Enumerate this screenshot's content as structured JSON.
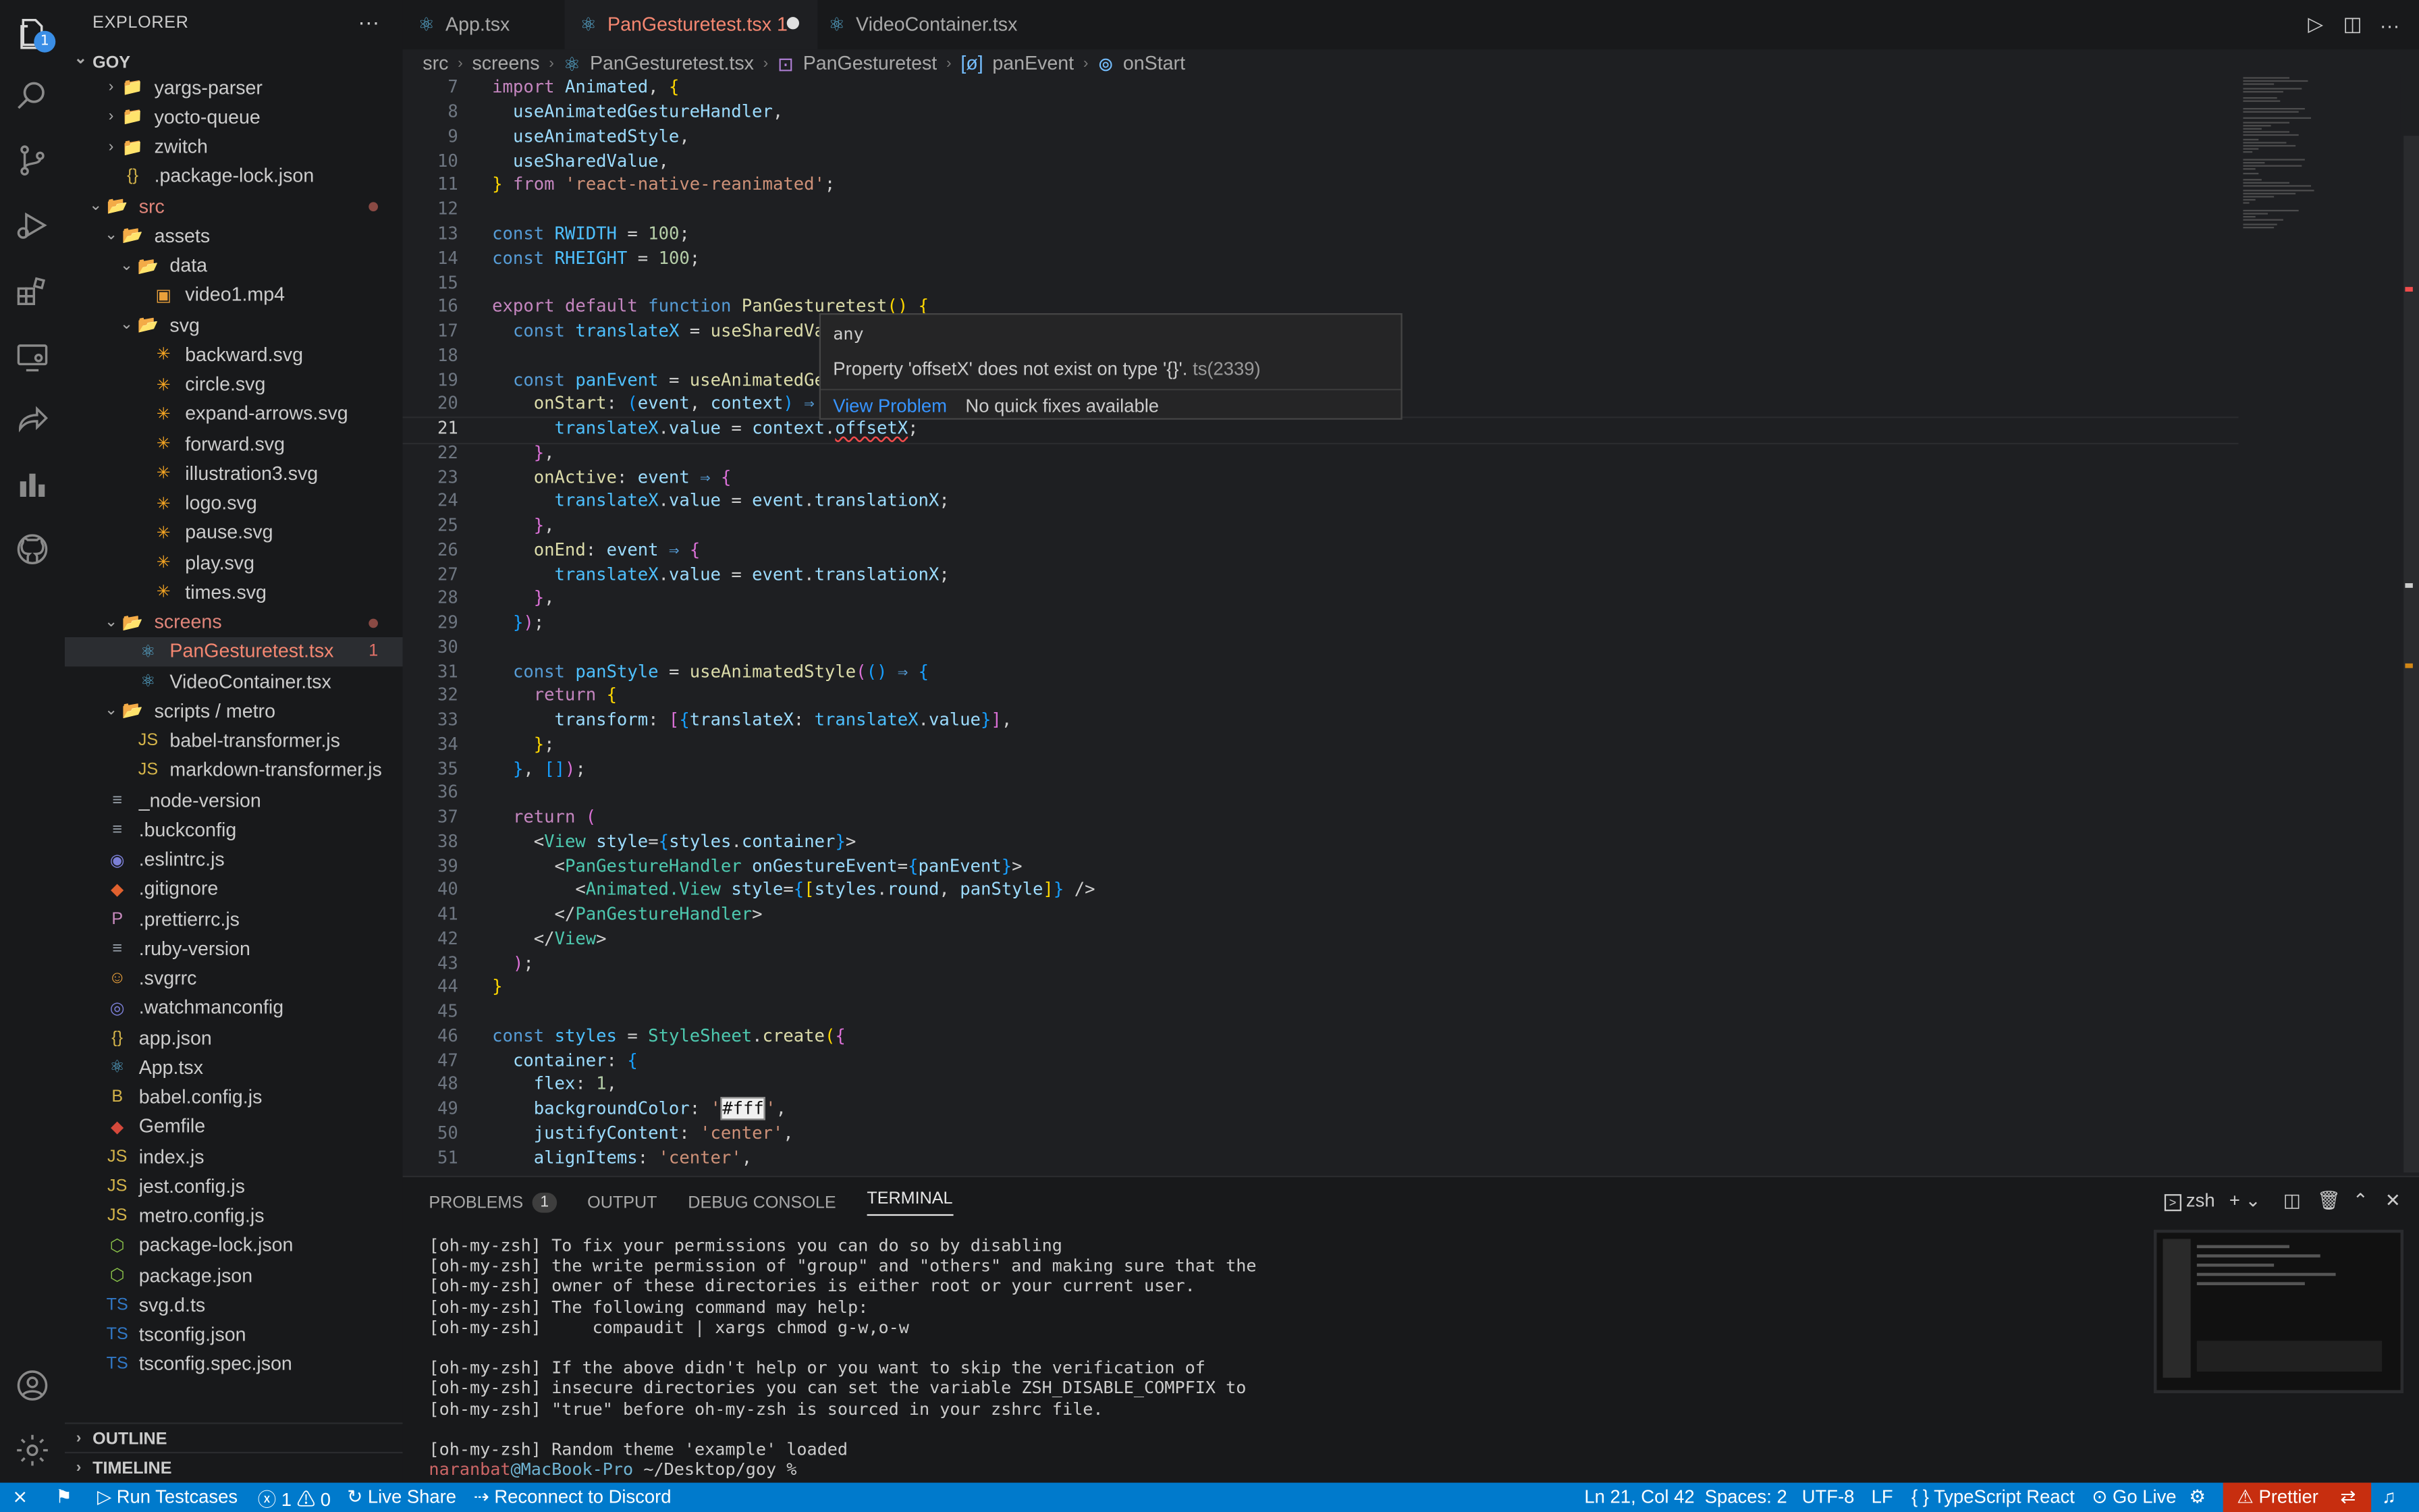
{
  "activity": {
    "explorer_badge": "1"
  },
  "sidebar": {
    "title": "EXPLORER",
    "more": "···",
    "root": "GOY",
    "items": [
      {
        "label": "yargs-parser",
        "kind": "folder",
        "depth": 1
      },
      {
        "label": "yocto-queue",
        "kind": "folder",
        "depth": 1
      },
      {
        "label": "zwitch",
        "kind": "folder",
        "depth": 1
      },
      {
        "label": ".package-lock.json",
        "kind": "json",
        "depth": 1
      },
      {
        "label": "src",
        "kind": "folder-open",
        "depth": 0
      },
      {
        "label": "assets",
        "kind": "folder-open",
        "depth": 1
      },
      {
        "label": "data",
        "kind": "folder-open",
        "depth": 2
      },
      {
        "label": "video1.mp4",
        "kind": "media",
        "depth": 3
      },
      {
        "label": "svg",
        "kind": "folder-open",
        "depth": 2
      },
      {
        "label": "backward.svg",
        "kind": "svg",
        "depth": 3
      },
      {
        "label": "circle.svg",
        "kind": "svg",
        "depth": 3
      },
      {
        "label": "expand-arrows.svg",
        "kind": "svg",
        "depth": 3
      },
      {
        "label": "forward.svg",
        "kind": "svg",
        "depth": 3
      },
      {
        "label": "illustration3.svg",
        "kind": "svg",
        "depth": 3
      },
      {
        "label": "logo.svg",
        "kind": "svg",
        "depth": 3
      },
      {
        "label": "pause.svg",
        "kind": "svg",
        "depth": 3
      },
      {
        "label": "play.svg",
        "kind": "svg",
        "depth": 3
      },
      {
        "label": "times.svg",
        "kind": "svg",
        "depth": 3
      },
      {
        "label": "screens",
        "kind": "folder-open",
        "depth": 1
      },
      {
        "label": "PanGesturetest.tsx",
        "kind": "react",
        "depth": 2,
        "problems": "1"
      },
      {
        "label": "VideoContainer.tsx",
        "kind": "react",
        "depth": 2
      },
      {
        "label": "scripts / metro",
        "kind": "folder-open",
        "depth": 1
      },
      {
        "label": "babel-transformer.js",
        "kind": "js",
        "depth": 2
      },
      {
        "label": "markdown-transformer.js",
        "kind": "js",
        "depth": 2
      },
      {
        "label": "_node-version",
        "kind": "text",
        "depth": 0
      },
      {
        "label": ".buckconfig",
        "kind": "text",
        "depth": 0
      },
      {
        "label": ".eslintrc.js",
        "kind": "eslint",
        "depth": 0
      },
      {
        "label": ".gitignore",
        "kind": "git",
        "depth": 0
      },
      {
        "label": ".prettierrc.js",
        "kind": "prettier",
        "depth": 0
      },
      {
        "label": ".ruby-version",
        "kind": "text",
        "depth": 0
      },
      {
        "label": ".svgrrc",
        "kind": "svgr",
        "depth": 0
      },
      {
        "label": ".watchmanconfig",
        "kind": "watchman",
        "depth": 0
      },
      {
        "label": "app.json",
        "kind": "json",
        "depth": 0
      },
      {
        "label": "App.tsx",
        "kind": "react",
        "depth": 0
      },
      {
        "label": "babel.config.js",
        "kind": "babel",
        "depth": 0
      },
      {
        "label": "Gemfile",
        "kind": "ruby",
        "depth": 0
      },
      {
        "label": "index.js",
        "kind": "js",
        "depth": 0
      },
      {
        "label": "jest.config.js",
        "kind": "js",
        "depth": 0
      },
      {
        "label": "metro.config.js",
        "kind": "js",
        "depth": 0
      },
      {
        "label": "package-lock.json",
        "kind": "node",
        "depth": 0
      },
      {
        "label": "package.json",
        "kind": "node",
        "depth": 0
      },
      {
        "label": "svg.d.ts",
        "kind": "ts",
        "depth": 0
      },
      {
        "label": "tsconfig.json",
        "kind": "ts",
        "depth": 0
      },
      {
        "label": "tsconfig.spec.json",
        "kind": "ts",
        "depth": 0
      }
    ],
    "outline": "OUTLINE",
    "timeline": "TIMELINE"
  },
  "tabs": [
    {
      "label": "App.tsx"
    },
    {
      "label": "PanGesturetest.tsx 1"
    },
    {
      "label": "VideoContainer.tsx"
    }
  ],
  "breadcrumb": [
    "src",
    "screens",
    "PanGesturetest.tsx",
    "PanGesturetest",
    "panEvent",
    "onStart"
  ],
  "editor": {
    "line_numbers": [
      "7",
      "8",
      "9",
      "10",
      "11",
      "12",
      "13",
      "14",
      "15",
      "16",
      "17",
      "18",
      "19",
      "20",
      "21",
      "22",
      "23",
      "24",
      "25",
      "26",
      "27",
      "28",
      "29",
      "30",
      "31",
      "32",
      "33",
      "34",
      "35",
      "36",
      "37",
      "38",
      "39",
      "40",
      "41",
      "42",
      "43",
      "44",
      "45",
      "46",
      "47",
      "48",
      "49",
      "50",
      "51"
    ],
    "current_line": "21"
  },
  "hover": {
    "type": "any",
    "message": "Property 'offsetX' does not exist on type '{}'.",
    "code": "ts(2339)",
    "view_problem": "View Problem",
    "no_fix": "No quick fixes available"
  },
  "panel": {
    "tabs": [
      "PROBLEMS",
      "OUTPUT",
      "DEBUG CONSOLE",
      "TERMINAL"
    ],
    "problems_count": "1",
    "shell": "zsh",
    "terminal_lines": [
      "[oh-my-zsh] To fix your permissions you can do so by disabling",
      "[oh-my-zsh] the write permission of \"group\" and \"others\" and making sure that the",
      "[oh-my-zsh] owner of these directories is either root or your current user.",
      "[oh-my-zsh] The following command may help:",
      "[oh-my-zsh]     compaudit | xargs chmod g-w,o-w",
      "",
      "[oh-my-zsh] If the above didn't help or you want to skip the verification of",
      "[oh-my-zsh] insecure directories you can set the variable ZSH_DISABLE_COMPFIX to",
      "[oh-my-zsh] \"true\" before oh-my-zsh is sourced in your zshrc file.",
      "",
      "[oh-my-zsh] Random theme 'example' loaded"
    ],
    "prompt_user": "naranbat",
    "prompt_host": "@MacBook-Pro",
    "prompt_path": " ~/Desktop/goy %"
  },
  "status": {
    "run": "Run Testcases",
    "errors": "1",
    "warnings": "0",
    "liveshare": "Live Share",
    "discord": "Reconnect to Discord",
    "position": "Ln 21, Col 42",
    "spaces": "Spaces: 2",
    "encoding": "UTF-8",
    "eol": "LF",
    "language": "TypeScript React",
    "golive": "Go Live",
    "prettier": "Prettier"
  },
  "colors": {
    "accent": "#007acc",
    "error": "#c72e0f",
    "tab_active_text": "#f48771"
  }
}
